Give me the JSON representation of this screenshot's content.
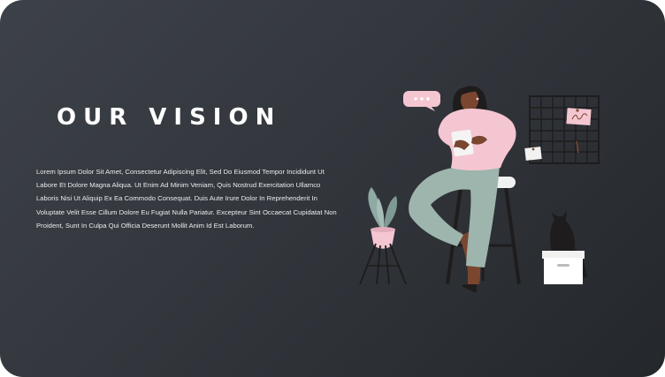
{
  "slide": {
    "title": "OUR VISION",
    "body": "Lorem Ipsum Dolor Sit Amet, Consectetur Adipiscing Elit, Sed Do Eiusmod Tempor Incididunt Ut Labore Et Dolore Magna Aliqua. Ut Enim Ad Minim Veniam, Quis Nostrud Exercitation Ullamco Laboris Nisi Ut Aliquip Ex Ea Commodo Consequat. Duis Aute Irure Dolor In Reprehenderit In Voluptate Velit Esse Cillum Dolore Eu Fugiat Nulla Pariatur. Excepteur Sint Occaecat Cupidatat Non Proident, Sunt In Culpa Qui Officia Deserunt Mollit Anim Id Est Laborum."
  },
  "colors": {
    "background_start": "#3d4148",
    "background_end": "#24272b",
    "title": "#ffffff",
    "body": "#e9ebee",
    "sweater_pink": "#f4c6d1",
    "pants_sage": "#9eb5ad",
    "plant_green": "#8fa9a3",
    "dark_ink": "#1e1c1d",
    "skin": "#7a4630"
  },
  "illustration": {
    "scene": "woman-reading-on-stool",
    "elements": [
      "speech-bubble-icon",
      "woman-figure",
      "bar-stool",
      "potted-plant",
      "grid-board",
      "pinned-note",
      "cat-silhouette",
      "white-box"
    ]
  }
}
